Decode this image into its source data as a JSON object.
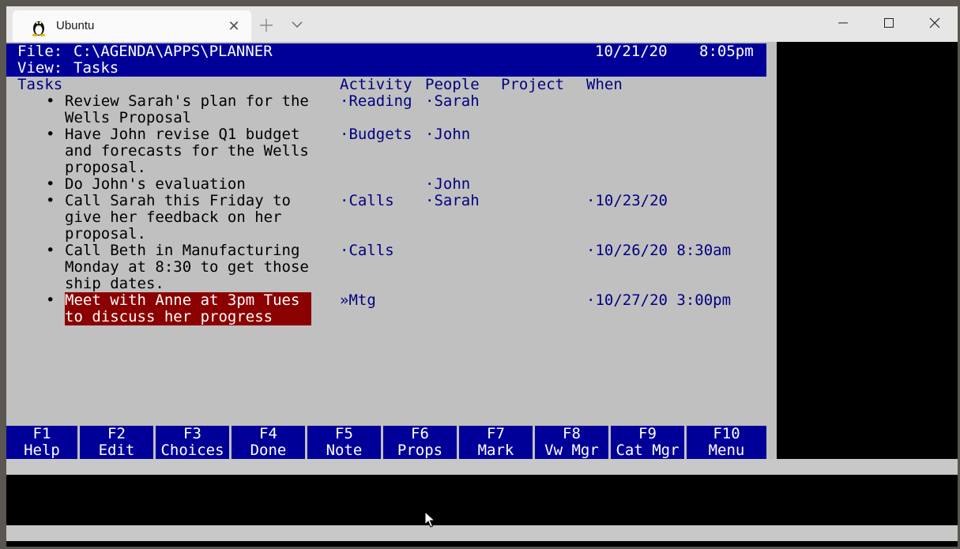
{
  "tab": {
    "title": "Ubuntu",
    "icon": "linux-penguin-icon"
  },
  "header": {
    "file_label": "File:",
    "file_path": "C:\\AGENDA\\APPS\\PLANNER",
    "date": "10/21/20",
    "time": "8:05pm",
    "view_label": "View:",
    "view_name": "Tasks"
  },
  "columns": {
    "tasks": "Tasks",
    "activity": "Activity",
    "people": "People",
    "project": "Project",
    "when": "When"
  },
  "tasks": [
    {
      "lines": [
        "Review Sarah's plan for the",
        "Wells Proposal"
      ],
      "activity": "·Reading",
      "people": "·Sarah",
      "when": ""
    },
    {
      "lines": [
        "Have John revise Q1 budget",
        "and forecasts for the Wells",
        "proposal."
      ],
      "activity": "·Budgets",
      "people": "·John",
      "when": ""
    },
    {
      "lines": [
        "Do John's evaluation"
      ],
      "activity": "",
      "people": "·John",
      "when": ""
    },
    {
      "lines": [
        "Call Sarah this Friday to",
        "give her feedback on her",
        "proposal."
      ],
      "activity": "·Calls",
      "people": "·Sarah",
      "when": "·10/23/20"
    },
    {
      "lines": [
        "Call Beth in Manufacturing",
        "Monday at 8:30 to get those",
        "ship dates."
      ],
      "activity": "·Calls",
      "people": "",
      "when": "·10/26/20 8:30am"
    },
    {
      "lines": [
        "Meet with Anne at 3pm Tues",
        "to discuss her progress"
      ],
      "activity": "»Mtg",
      "people": "",
      "when": "·10/27/20 3:00pm",
      "selected": true
    }
  ],
  "bullet": "•",
  "function_keys": [
    {
      "key": "F1",
      "label": "Help"
    },
    {
      "key": "F2",
      "label": "Edit"
    },
    {
      "key": "F3",
      "label": "Choices"
    },
    {
      "key": "F4",
      "label": "Done"
    },
    {
      "key": "F5",
      "label": "Note"
    },
    {
      "key": "F6",
      "label": "Props"
    },
    {
      "key": "F7",
      "label": "Mark"
    },
    {
      "key": "F8",
      "label": "Vw Mgr"
    },
    {
      "key": "F9",
      "label": "Cat Mgr"
    },
    {
      "key": "F10",
      "label": "Menu"
    }
  ],
  "colors": {
    "header_bg": "#000099",
    "terminal_bg": "#c0c0c0",
    "column_text": "#000080",
    "selection_bg": "#8b0000"
  }
}
